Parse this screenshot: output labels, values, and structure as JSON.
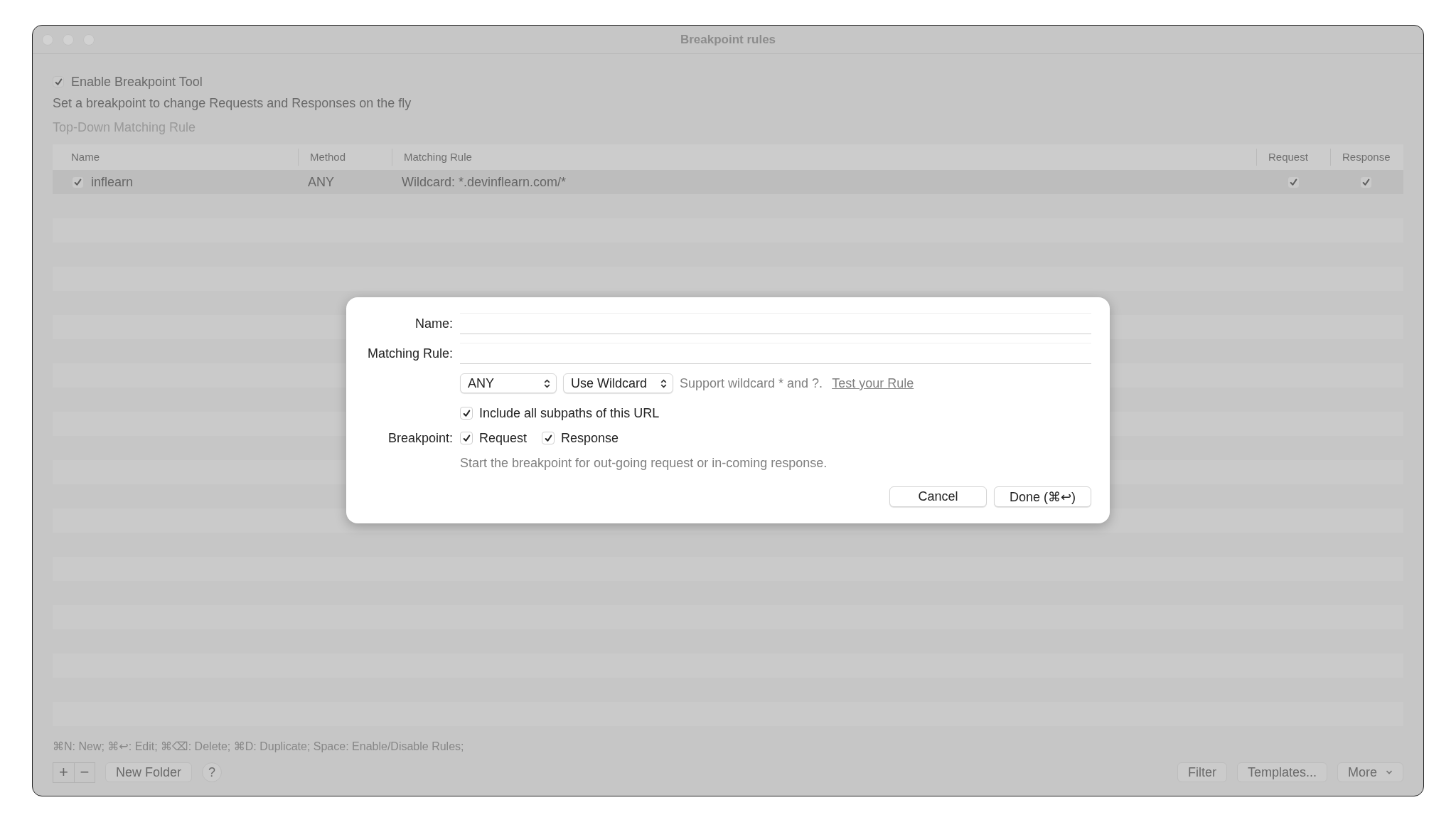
{
  "window": {
    "title": "Breakpoint rules"
  },
  "enable_tool": {
    "label": "Enable Breakpoint Tool",
    "checked": true
  },
  "description": "Set a breakpoint to change Requests and Responses on the fly",
  "matching_mode": "Top-Down Matching Rule",
  "table": {
    "columns": [
      "Name",
      "Method",
      "Matching Rule",
      "Request",
      "Response"
    ],
    "rows": [
      {
        "enabled": true,
        "name": "inflearn",
        "method": "ANY",
        "matching_rule": "Wildcard: *.devinflearn.com/*",
        "request": true,
        "response": true,
        "selected": true
      }
    ]
  },
  "shortcuts_hint": "⌘N: New; ⌘↩: Edit; ⌘⌫: Delete; ⌘D: Duplicate; Space: Enable/Disable Rules;",
  "footer": {
    "add": "+",
    "remove": "−",
    "new_folder": "New Folder",
    "help": "?",
    "filter": "Filter",
    "templates": "Templates...",
    "more": "More"
  },
  "dialog": {
    "name_label": "Name:",
    "rule_label": "Matching Rule:",
    "method": "ANY",
    "match_type": "Use Wildcard",
    "hint": "Support wildcard * and ?.",
    "test_link": "Test your Rule",
    "include_subpaths": {
      "label": "Include all subpaths of this URL",
      "checked": true
    },
    "breakpoint_label": "Breakpoint:",
    "request": {
      "label": "Request",
      "checked": true
    },
    "response": {
      "label": "Response",
      "checked": true
    },
    "breakpoint_hint": "Start the breakpoint for out-going request or in-coming response.",
    "cancel": "Cancel",
    "done": "Done (⌘↩)"
  }
}
